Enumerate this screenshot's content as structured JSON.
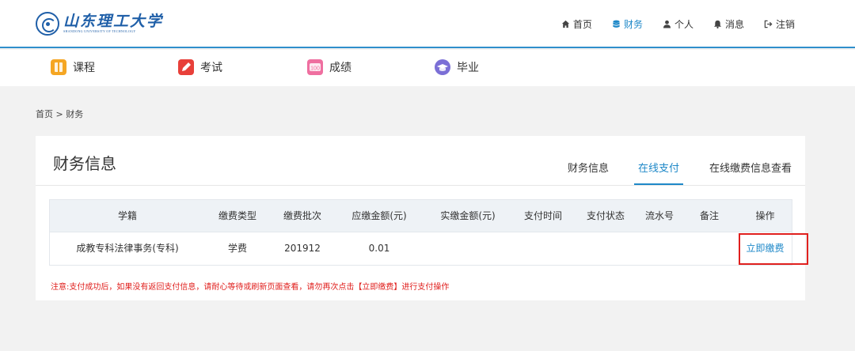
{
  "logo": {
    "name": "山东理工大学",
    "subtitle": "SHANDONG UNIVERSITY OF TECHNOLOGY"
  },
  "topnav": [
    {
      "label": "首页",
      "icon": "home-icon",
      "active": false
    },
    {
      "label": "财务",
      "icon": "database-icon",
      "active": true
    },
    {
      "label": "个人",
      "icon": "user-icon",
      "active": false
    },
    {
      "label": "消息",
      "icon": "bell-icon",
      "active": false
    },
    {
      "label": "注销",
      "icon": "logout-icon",
      "active": false
    }
  ],
  "subnav": [
    {
      "label": "课程",
      "icon": "book-icon",
      "color": "#f5a623"
    },
    {
      "label": "考试",
      "icon": "pen-icon",
      "color": "#e8403a"
    },
    {
      "label": "成绩",
      "icon": "score-icon",
      "color": "#ef6fa0"
    },
    {
      "label": "毕业",
      "icon": "graduation-icon",
      "color": "#7b6fd6"
    }
  ],
  "breadcrumb": "首页 > 财务",
  "panel": {
    "title": "财务信息",
    "tabs": [
      {
        "label": "财务信息",
        "active": false
      },
      {
        "label": "在线支付",
        "active": true
      },
      {
        "label": "在线缴费信息查看",
        "active": false
      }
    ]
  },
  "table": {
    "headers": [
      "学籍",
      "缴费类型",
      "缴费批次",
      "应缴金额(元)",
      "实缴金额(元)",
      "支付时间",
      "支付状态",
      "流水号",
      "备注",
      "操作"
    ],
    "rows": [
      {
        "xueji": "成教专科法律事务(专科)",
        "type": "学费",
        "batch": "201912",
        "due": "0.01",
        "paid": "",
        "time": "",
        "status": "",
        "serial": "",
        "remark": "",
        "action": "立即缴费"
      }
    ]
  },
  "notice": "注意:支付成功后，如果没有返回支付信息，请耐心等待或刷新页面查看，请勿再次点击【立即缴费】进行支付操作",
  "colors": {
    "accent": "#1e88c8",
    "warning": "#e0201e",
    "header_line": "#2f8fcb"
  }
}
